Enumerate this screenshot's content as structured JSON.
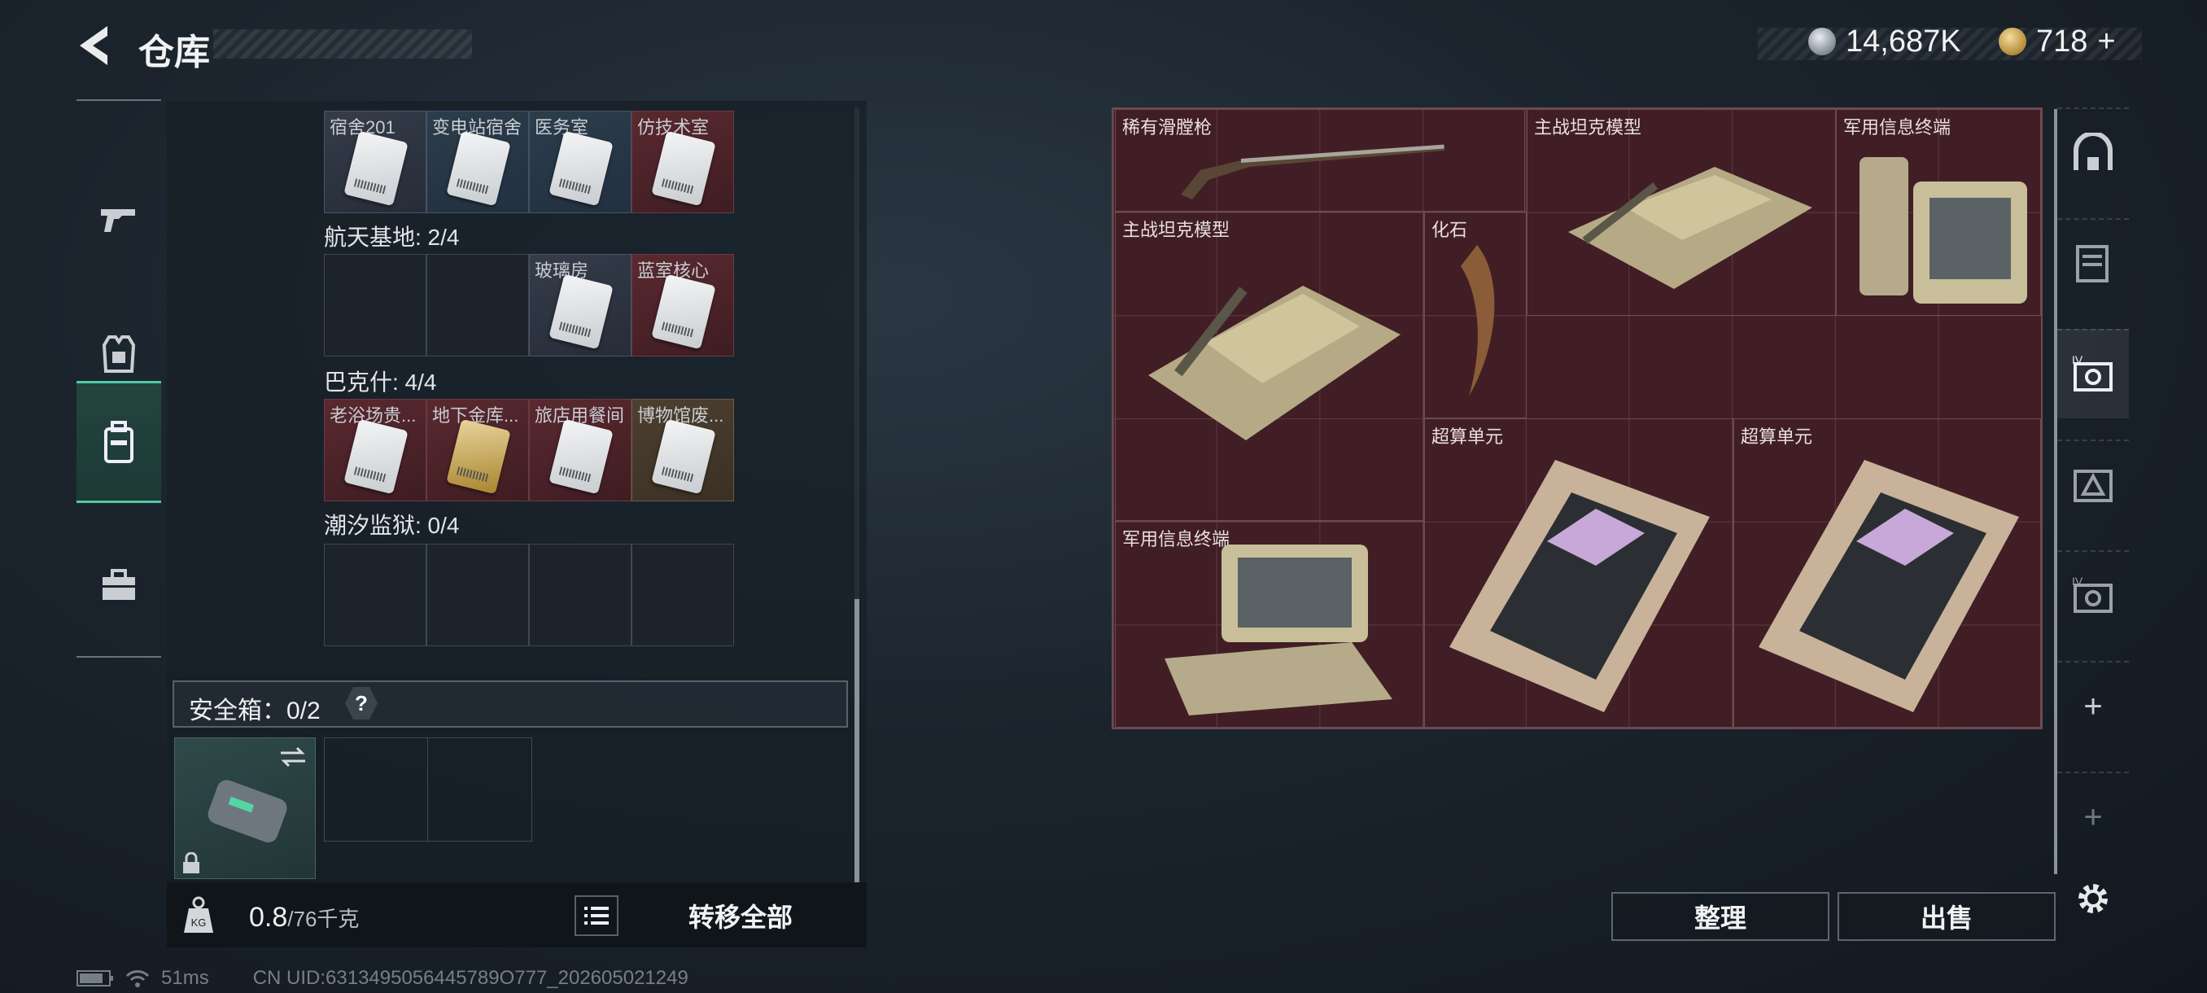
{
  "header": {
    "title": "仓库",
    "silver_amount": "14,687K",
    "gold_amount": "718",
    "add_symbol": "+"
  },
  "left_rail": {
    "items": [
      "weapon",
      "armor",
      "backpack",
      "toolbox"
    ],
    "active": "backpack"
  },
  "inventory": {
    "row0_labels": [
      "宿舍201",
      "变电站宿舍",
      "医务室",
      "仿技术室"
    ],
    "sections": [
      {
        "title": "航天基地: 2/4",
        "labels": [
          "",
          "",
          "玻璃房",
          "蓝室核心"
        ]
      },
      {
        "title": "巴克什: 4/4",
        "labels": [
          "老浴场贵...",
          "地下金库...",
          "旅店用餐间",
          "博物馆废..."
        ]
      },
      {
        "title": "潮汐监狱: 0/4",
        "labels": [
          "",
          "",
          "",
          ""
        ]
      }
    ]
  },
  "safe_box": {
    "label": "安全箱：0/2",
    "help": "?"
  },
  "bottom": {
    "weight": "0.8",
    "weight_max": "/76千克",
    "weight_icon": "KG",
    "transfer_all": "转移全部"
  },
  "stash": {
    "items": [
      {
        "label": "稀有滑膛枪"
      },
      {
        "label": "主战坦克模型"
      },
      {
        "label": "军用信息终端"
      },
      {
        "label": "主战坦克模型"
      },
      {
        "label": "化石"
      },
      {
        "label": "超算单元"
      },
      {
        "label": "超算单元"
      },
      {
        "label": "军用信息终端"
      }
    ]
  },
  "actions": {
    "sort": "整理",
    "sell": "出售"
  },
  "right_rail": {
    "add1": "+",
    "add2": "+"
  },
  "status": {
    "ping": "51ms",
    "uid": "CN UID:6313495056445789O777_202605021249"
  },
  "colors": {
    "accent": "#4ec9a3",
    "stash_bg": "#411e25"
  }
}
